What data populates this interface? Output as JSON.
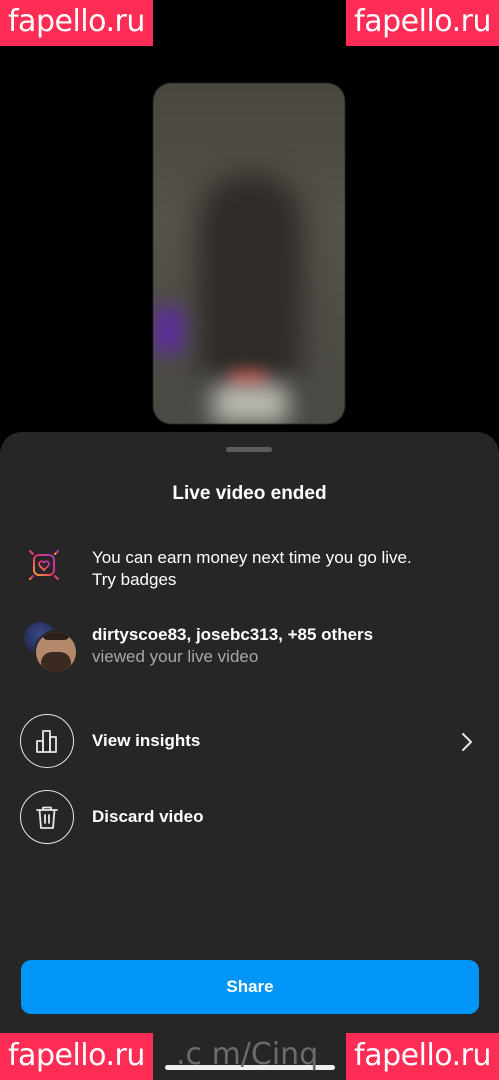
{
  "watermarks": {
    "top_left": "fapello.ru",
    "top_right": "fapello.ru",
    "bottom_left": "fapello.ru",
    "bottom_right": "fapello.ru",
    "bottom_url": ".c m/Cinq"
  },
  "sheet": {
    "title": "Live video ended",
    "badges_line1": "You can earn money next time you go live.",
    "badges_line2": "Try badges",
    "viewers_line1": "dirtyscoe83, josebc313, +85 others",
    "viewers_line2": "viewed your live video",
    "insights_label": "View insights",
    "discard_label": "Discard video",
    "share_label": "Share"
  },
  "colors": {
    "sheet_bg": "#262626",
    "share_button": "#0095f6",
    "watermark": "#ff2d55"
  },
  "icons": {
    "badge": "heart-badge-icon",
    "insights": "bar-chart-icon",
    "discard": "trash-icon",
    "chevron": "chevron-right-icon"
  }
}
